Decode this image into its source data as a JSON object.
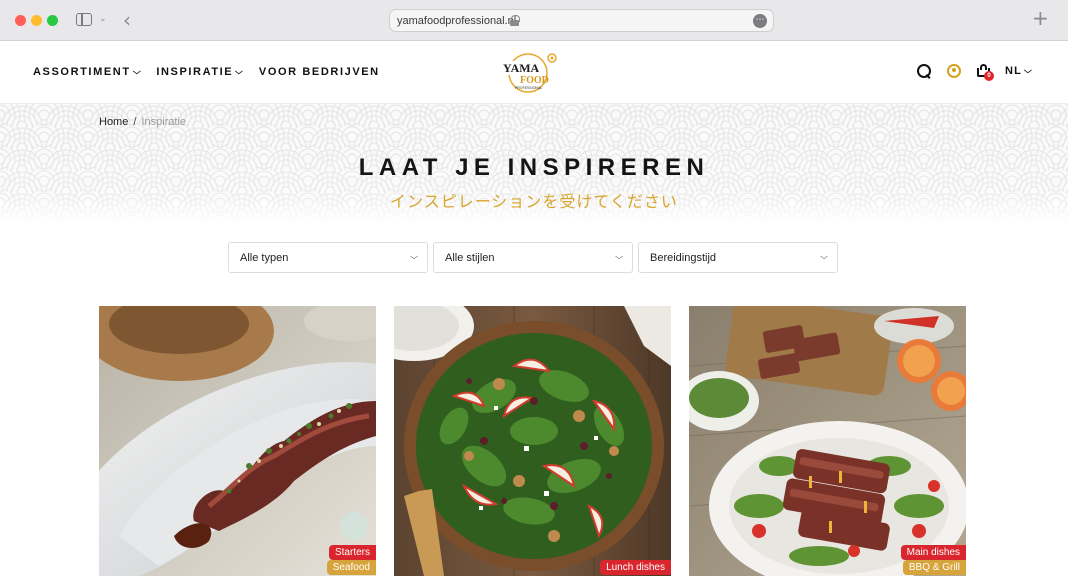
{
  "browser": {
    "url": "yamafoodprofessional.nl"
  },
  "header": {
    "nav": [
      {
        "label": "ASSORTIMENT",
        "has_dropdown": true
      },
      {
        "label": "INSPIRATIE",
        "has_dropdown": true
      },
      {
        "label": "VOOR BEDRIJVEN",
        "has_dropdown": false
      }
    ],
    "logo": {
      "line1": "YAMA",
      "line2": "FOOD",
      "line3": "PROFESSIONAL"
    },
    "cart_count": "0",
    "language": "NL"
  },
  "breadcrumb": {
    "home": "Home",
    "separator": "/",
    "current": "Inspiratie"
  },
  "hero": {
    "title": "LAAT JE INSPIREREN",
    "subtitle": "インスピレーションを受けてください"
  },
  "filters": [
    {
      "label": "Alle typen"
    },
    {
      "label": "Alle stijlen"
    },
    {
      "label": "Bereidingstijd"
    }
  ],
  "recipes": [
    {
      "tags": [
        {
          "label": "Starters",
          "color": "#d9262e"
        },
        {
          "label": "Seafood",
          "color": "#d6a43a"
        }
      ],
      "image": "seared-beef-tataki"
    },
    {
      "tags": [
        {
          "label": "Lunch dishes",
          "color": "#d9262e"
        }
      ],
      "image": "spinach-apple-salad"
    },
    {
      "tags": [
        {
          "label": "Main dishes",
          "color": "#d9262e"
        },
        {
          "label": "BBQ & Grill",
          "color": "#d6a43a"
        }
      ],
      "image": "grilled-tuna-salad"
    }
  ],
  "colors": {
    "accent_gold": "#d8a42c",
    "tag_red": "#d9262e",
    "tag_gold": "#d6a43a"
  },
  "icons": [
    "sidebar-icon",
    "back-arrow-icon",
    "lock-icon",
    "more-icon",
    "plus-icon",
    "search-icon",
    "user-icon",
    "cart-icon",
    "chevron-down-icon"
  ]
}
